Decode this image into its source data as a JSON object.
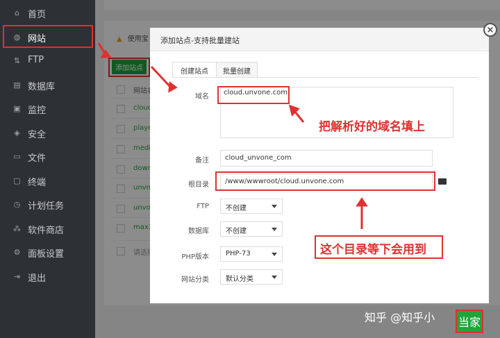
{
  "sidebar": {
    "items": [
      {
        "label": "首页",
        "icon": "home-icon"
      },
      {
        "label": "网站",
        "icon": "globe-icon"
      },
      {
        "label": "FTP",
        "icon": "ftp-icon"
      },
      {
        "label": "数据库",
        "icon": "database-icon"
      },
      {
        "label": "监控",
        "icon": "monitor-icon"
      },
      {
        "label": "安全",
        "icon": "shield-icon"
      },
      {
        "label": "文件",
        "icon": "folder-icon"
      },
      {
        "label": "终端",
        "icon": "terminal-icon"
      },
      {
        "label": "计划任务",
        "icon": "clock-icon"
      },
      {
        "label": "软件商店",
        "icon": "store-icon"
      },
      {
        "label": "面板设置",
        "icon": "gear-icon"
      },
      {
        "label": "退出",
        "icon": "logout-icon"
      }
    ]
  },
  "background": {
    "warning_text": "使用宝",
    "add_site_label": "添加站点",
    "table_header": "网站名",
    "rows": [
      "cloud",
      "player",
      "media",
      "down",
      "unvm",
      "unvor",
      "max3."
    ],
    "footer_text": "请选择"
  },
  "modal": {
    "title": "添加站点-支持批量建站",
    "tabs": [
      "创建站点",
      "批量创建"
    ],
    "form": {
      "domain_label": "域名",
      "domain_value": "cloud.unvone.com",
      "remark_label": "备注",
      "remark_value": "cloud_unvone_com",
      "root_label": "根目录",
      "root_value": "/www/wwwroot/cloud.unvone.com",
      "ftp_label": "FTP",
      "ftp_value": "不创建",
      "db_label": "数据库",
      "db_value": "不创建",
      "php_label": "PHP版本",
      "php_value": "PHP-73",
      "category_label": "网站分类",
      "category_value": "默认分类"
    },
    "close_symbol": "×"
  },
  "annotations": {
    "domain_note": "把解析好的域名填上",
    "root_note": "这个目录等下会用到"
  },
  "watermark": "知乎 @知乎小",
  "confirm_label": "当家",
  "colors": {
    "accent_green": "#20a53a",
    "annotation_red": "#e03030",
    "sidebar_bg": "#2d3035"
  }
}
